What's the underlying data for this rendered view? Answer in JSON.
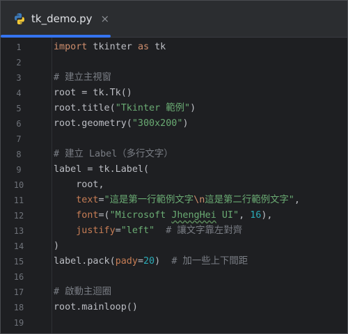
{
  "tab": {
    "filename": "tk_demo.py",
    "close": "×"
  },
  "lines": [
    {
      "n": "1",
      "parts": [
        [
          "kw",
          "import"
        ],
        [
          "p",
          " tkinter "
        ],
        [
          "kw",
          "as"
        ],
        [
          "p",
          " tk"
        ]
      ]
    },
    {
      "n": "2",
      "parts": []
    },
    {
      "n": "3",
      "parts": [
        [
          "cm",
          "# 建立主視窗"
        ]
      ]
    },
    {
      "n": "4",
      "parts": [
        [
          "p",
          "root = tk.Tk()"
        ]
      ]
    },
    {
      "n": "5",
      "parts": [
        [
          "p",
          "root.title("
        ],
        [
          "str",
          "\"Tkinter 範例\""
        ],
        [
          "p",
          ")"
        ]
      ]
    },
    {
      "n": "6",
      "parts": [
        [
          "p",
          "root.geometry("
        ],
        [
          "str",
          "\"300x200\""
        ],
        [
          "p",
          ")"
        ]
      ]
    },
    {
      "n": "7",
      "parts": []
    },
    {
      "n": "8",
      "parts": [
        [
          "cm",
          "# 建立 Label（多行文字）"
        ]
      ]
    },
    {
      "n": "9",
      "parts": [
        [
          "p",
          "label = tk.Label("
        ]
      ]
    },
    {
      "n": "10",
      "parts": [
        [
          "p",
          "    root,"
        ]
      ]
    },
    {
      "n": "11",
      "parts": [
        [
          "prm",
          "    text"
        ],
        [
          "p",
          "="
        ],
        [
          "str",
          "\"這是第一行範例文字"
        ],
        [
          "esc",
          "\\n"
        ],
        [
          "str",
          "這是第二行範例文字\""
        ],
        [
          "p",
          ","
        ]
      ]
    },
    {
      "n": "12",
      "parts": [
        [
          "prm",
          "    font"
        ],
        [
          "p",
          "=("
        ],
        [
          "str",
          "\"Microsoft "
        ],
        [
          "strw",
          "JhengHei"
        ],
        [
          "str",
          " UI\""
        ],
        [
          "p",
          ", "
        ],
        [
          "num",
          "16"
        ],
        [
          "p",
          "),"
        ]
      ]
    },
    {
      "n": "13",
      "parts": [
        [
          "prm",
          "    justify"
        ],
        [
          "p",
          "="
        ],
        [
          "str",
          "\"left\""
        ],
        [
          "p",
          "  "
        ],
        [
          "cm",
          "# 讓文字靠左對齊"
        ]
      ]
    },
    {
      "n": "14",
      "parts": [
        [
          "p",
          ")"
        ]
      ]
    },
    {
      "n": "15",
      "parts": [
        [
          "p",
          "label.pack("
        ],
        [
          "prm",
          "pady"
        ],
        [
          "p",
          "="
        ],
        [
          "num",
          "20"
        ],
        [
          "p",
          ")  "
        ],
        [
          "cm",
          "# 加一些上下間距"
        ]
      ]
    },
    {
      "n": "16",
      "parts": []
    },
    {
      "n": "17",
      "parts": [
        [
          "cm",
          "# 啟動主迴圈"
        ]
      ]
    },
    {
      "n": "18",
      "parts": [
        [
          "p",
          "root.mainloop()"
        ]
      ]
    },
    {
      "n": "19",
      "parts": []
    }
  ],
  "colors": {
    "keyword": "#cf8e6d",
    "string": "#6aab73",
    "comment": "#7a7e85",
    "param": "#c77d55",
    "number": "#2aacb8",
    "text": "#bcbec4",
    "accent": "#3574f0"
  },
  "icons": {
    "tab": "python-icon",
    "close": "close-icon"
  }
}
